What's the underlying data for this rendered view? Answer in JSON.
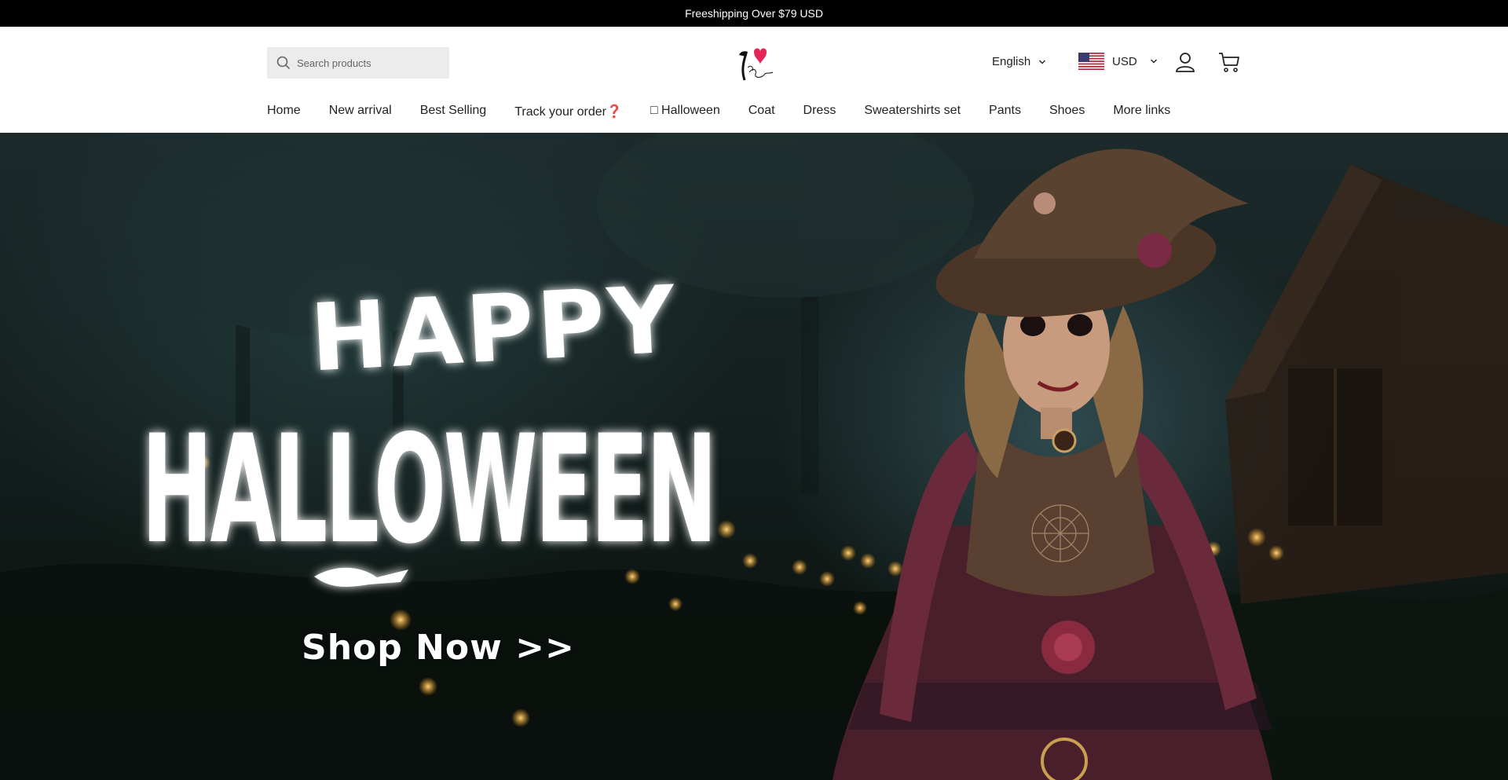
{
  "announcement": "Freeshipping Over $79 USD",
  "search": {
    "placeholder": "Search products"
  },
  "header": {
    "language": "English",
    "currency": "USD"
  },
  "nav": [
    {
      "label": "Home"
    },
    {
      "label": "New arrival"
    },
    {
      "label": "Best Selling"
    },
    {
      "label": "Track your order❓"
    },
    {
      "label": "□ Halloween"
    },
    {
      "label": "Coat"
    },
    {
      "label": "Dress"
    },
    {
      "label": "Sweatershirts set"
    },
    {
      "label": "Pants"
    },
    {
      "label": "Shoes"
    },
    {
      "label": "More links"
    }
  ],
  "hero": {
    "headline_line1": "HAPPY",
    "headline_line2": "HALLOWEEN",
    "cta": "Shop Now >>"
  },
  "colors": {
    "announce_bg": "#000000",
    "brand_heart": "#e6245c",
    "hero_text": "#ffffff"
  },
  "icons": [
    "search-icon",
    "chevron-down-icon",
    "us-flag-icon",
    "user-icon",
    "cart-icon"
  ]
}
